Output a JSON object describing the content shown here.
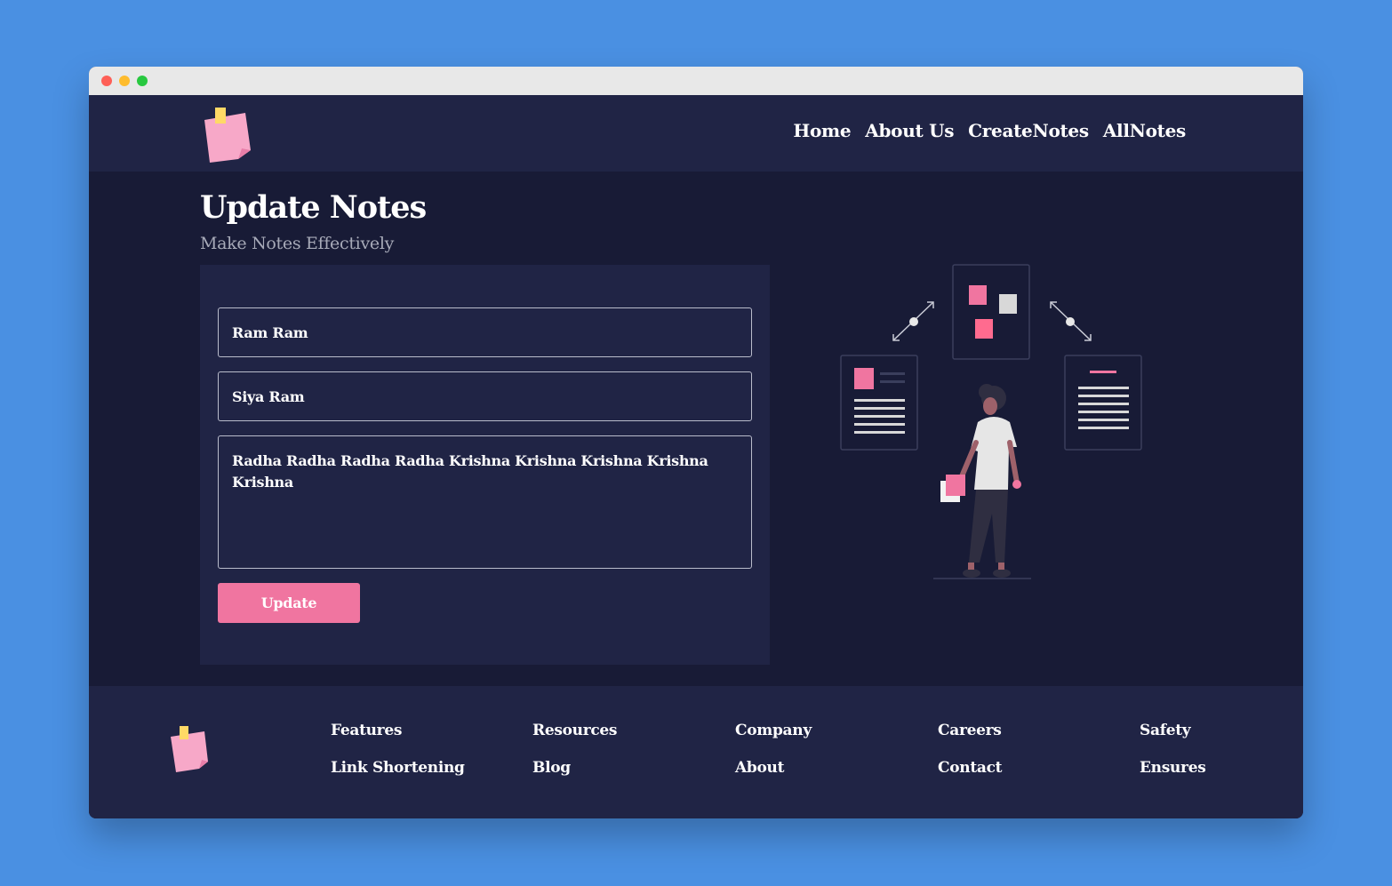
{
  "nav": {
    "items": [
      "Home",
      "About Us",
      "CreateNotes",
      "AllNotes"
    ]
  },
  "page": {
    "title": "Update Notes",
    "subtitle": "Make Notes Effectively"
  },
  "form": {
    "title_value": "Ram Ram",
    "subtitle_value": "Siya Ram",
    "description_value": "Radha Radha Radha Radha Krishna Krishna Krishna Krishna Krishna",
    "update_label": "Update"
  },
  "footer": {
    "columns": [
      [
        "Features",
        "Link Shortening"
      ],
      [
        "Resources",
        "Blog"
      ],
      [
        "Company",
        "About"
      ],
      [
        "Careers",
        "Contact"
      ],
      [
        "Safety",
        "Ensures"
      ]
    ]
  },
  "colors": {
    "accent": "#f075a0",
    "background": "#181b36",
    "panel": "#202445",
    "outer_background": "#4a90e2"
  },
  "icons": {
    "logo": "sticky-note-icon",
    "window_controls": [
      "close-dot",
      "minimize-dot",
      "maximize-dot"
    ]
  }
}
